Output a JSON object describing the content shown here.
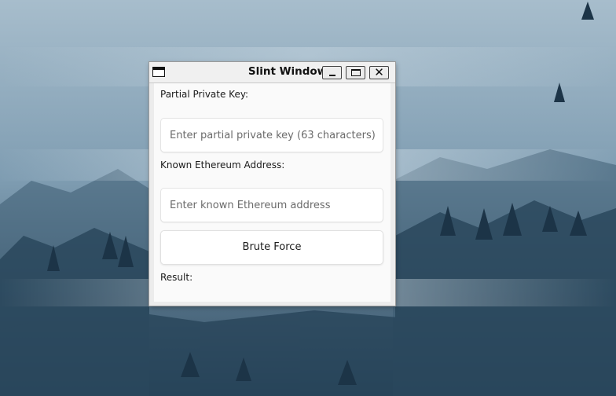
{
  "window": {
    "title": "Slint Window",
    "close_glyph": "✕"
  },
  "form": {
    "private_key_label": "Partial Private Key:",
    "private_key_placeholder": "Enter partial private key (63 characters)",
    "private_key_value": "",
    "address_label": "Known Ethereum Address:",
    "address_placeholder": "Enter known Ethereum address",
    "address_value": "",
    "button_label": "Brute Force",
    "result_label": "Result:"
  },
  "icons": {
    "window_menu": "window-menu-icon",
    "minimize": "minimize-icon",
    "maximize": "maximize-icon",
    "close": "close-icon"
  }
}
